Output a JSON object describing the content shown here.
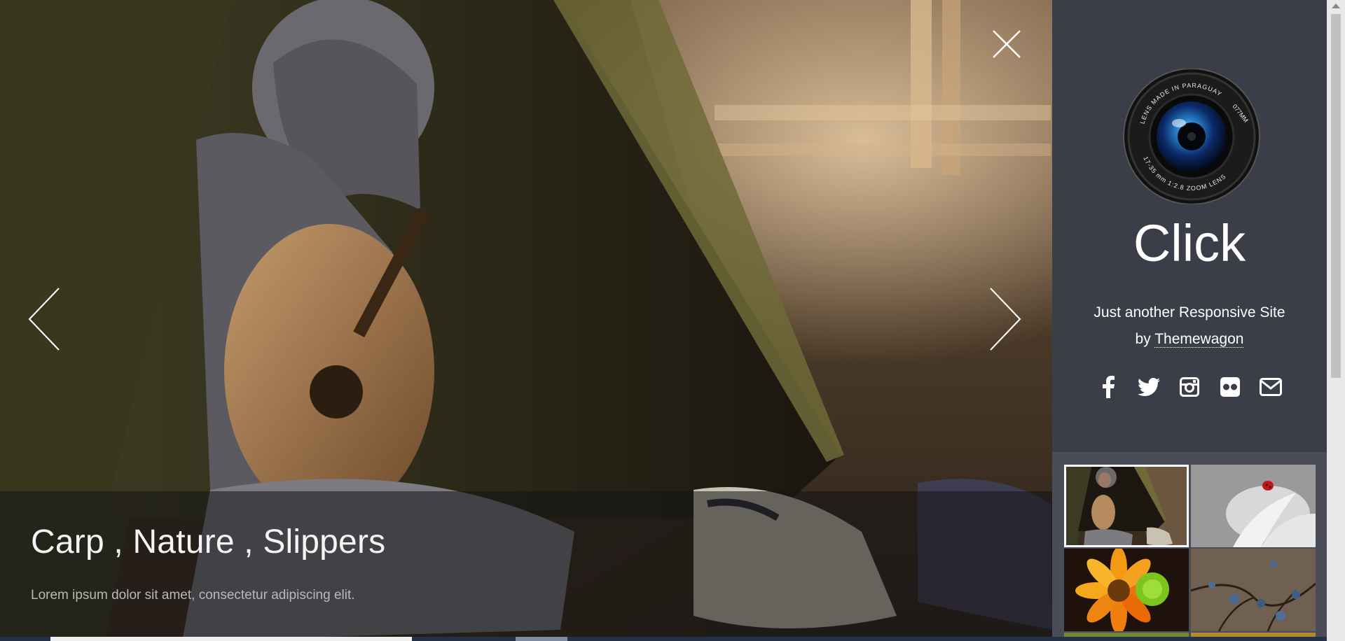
{
  "slide": {
    "title": "Carp , Nature , Slippers",
    "description": "Lorem ipsum dolor sit amet, consectetur adipiscing elit."
  },
  "sidebar": {
    "brand": "Click",
    "tagline_line1": "Just another Responsive Site",
    "tagline_by": "by",
    "tagline_link": "Themewagon",
    "logo_ring_text_top": "LENS MADE IN PARAGUAY",
    "logo_ring_text_mm": "077MM",
    "logo_ring_text_bottom": "17-35 mm  1:2.8   ZOOM LENS",
    "social": [
      "facebook-icon",
      "twitter-icon",
      "instagram-icon",
      "flickr-icon",
      "mail-icon"
    ]
  },
  "colors": {
    "sidebar_bg": "#3b3d48",
    "thumb_area_bg": "#4a4c57",
    "caption_overlay": "rgba(20,20,22,0.55)"
  }
}
